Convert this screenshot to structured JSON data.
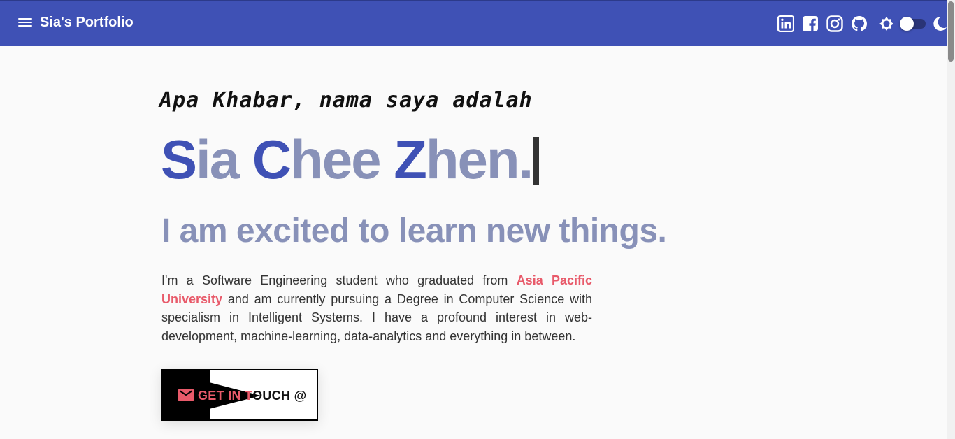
{
  "header": {
    "title": "Sia's Portfolio",
    "menu_icon": "hamburger-menu-icon",
    "social": [
      "linkedin-icon",
      "facebook-icon",
      "instagram-icon",
      "github-icon"
    ],
    "theme_toggle": {
      "light_icon": "sun-icon",
      "dark_icon": "moon-icon",
      "state": "light"
    }
  },
  "hero": {
    "greeting": "Apa Khabar, nama saya adalah",
    "name_parts": [
      {
        "text": "S",
        "style": "dark"
      },
      {
        "text": "ia ",
        "style": "light"
      },
      {
        "text": "C",
        "style": "dark"
      },
      {
        "text": "hee ",
        "style": "light"
      },
      {
        "text": "Z",
        "style": "dark"
      },
      {
        "text": "hen.",
        "style": "light"
      }
    ],
    "tagline": "I am excited to learn new things.",
    "bio_before": "I'm a Software Engineering student who graduated from ",
    "bio_university": "Asia Pacific University",
    "bio_after": " and am currently pursuing a Degree in Computer Science with specialism in Intelligent Systems. I have a profound interest in web-development, machine-learning, data-analytics and everything in between.",
    "cta_label": "GET IN TOUCH @"
  },
  "colors": {
    "primary": "#3f51b5",
    "muted": "#8891b8",
    "accent": "#e85a6a"
  }
}
